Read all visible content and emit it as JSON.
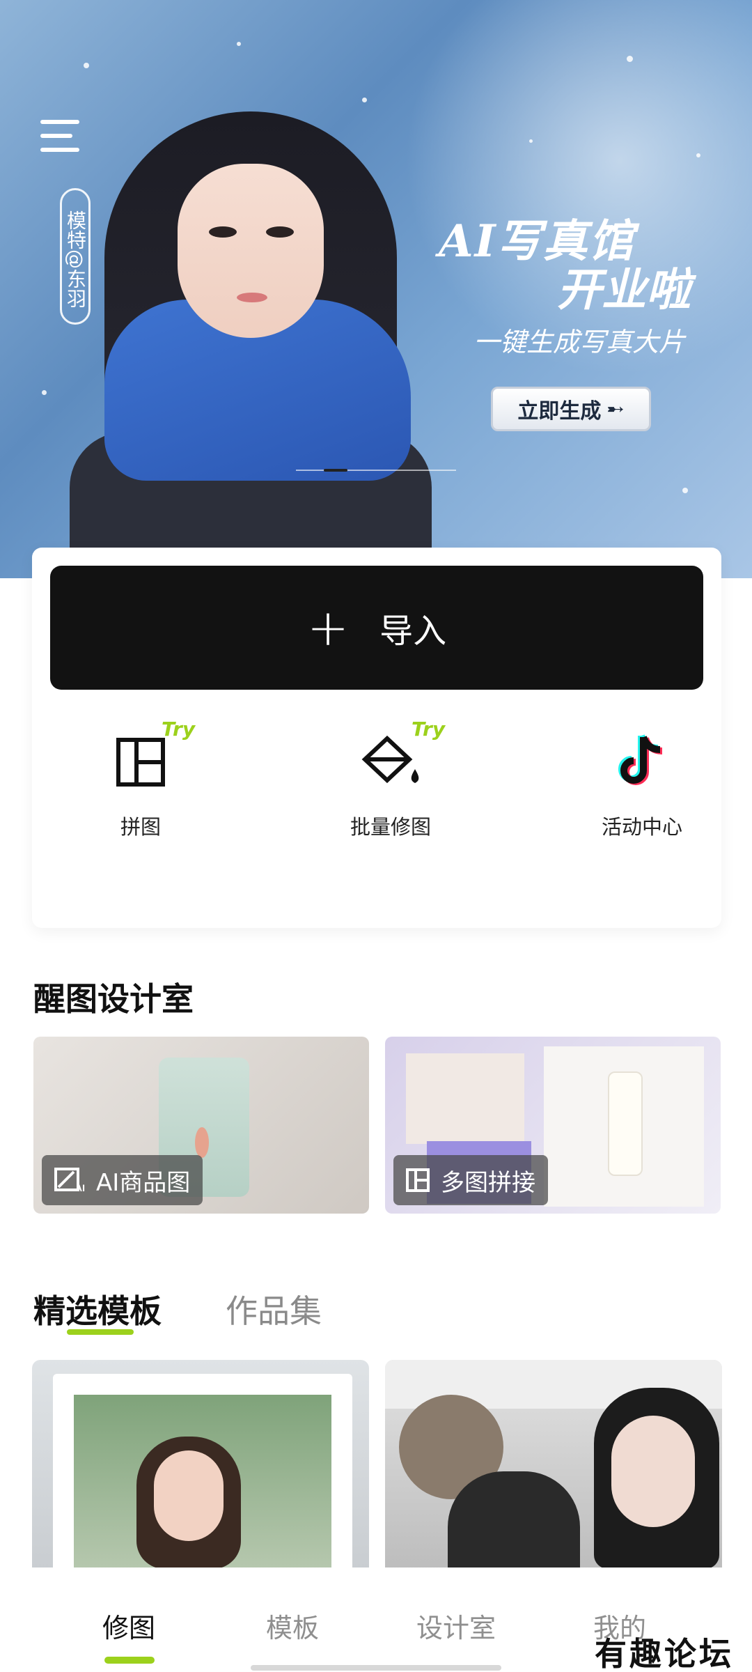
{
  "hero": {
    "model_tag": "模特@东羽",
    "title_line1": "AI写真馆",
    "title_line2": "开业啦",
    "subtitle": "一键生成写真大片",
    "cta_label": "立即生成",
    "cta_arrow": "➸"
  },
  "card": {
    "import_plus": "+",
    "import_label": "导入",
    "quick_actions": [
      {
        "label": "拼图",
        "icon": "collage-grid-icon",
        "badge": "Try"
      },
      {
        "label": "批量修图",
        "icon": "batch-edit-bucket-icon",
        "badge": "Try"
      },
      {
        "label": "活动中心",
        "icon": "tiktok-logo-icon",
        "badge": ""
      }
    ]
  },
  "design_room": {
    "title": "醒图设计室",
    "tiles": [
      {
        "label": "AI商品图",
        "icon": "ai-product-icon"
      },
      {
        "label": "多图拼接",
        "icon": "grid-collage-icon"
      }
    ]
  },
  "tabs": [
    {
      "label": "精选模板",
      "active": true
    },
    {
      "label": "作品集",
      "active": false
    }
  ],
  "bottom_nav": [
    {
      "label": "修图",
      "active": true
    },
    {
      "label": "模板",
      "active": false
    },
    {
      "label": "设计室",
      "active": false
    },
    {
      "label": "我的",
      "active": false
    }
  ],
  "watermark": "有趣论坛",
  "colors": {
    "accent_green": "#9cd11c",
    "import_bg": "#121212",
    "hero_blue": "#5e8cbf"
  }
}
